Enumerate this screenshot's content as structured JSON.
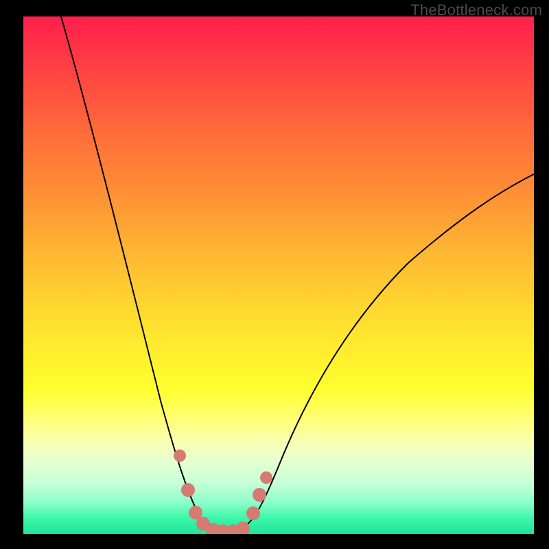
{
  "watermark": "TheBottleneck.com",
  "colors": {
    "background": "#000000",
    "gradient_top": "#ff1f4b",
    "gradient_bottom": "#20e39a",
    "curve": "#000000",
    "markers": "#d77a72"
  },
  "chart_data": {
    "type": "line",
    "title": "",
    "xlabel": "",
    "ylabel": "",
    "xlim": [
      0,
      100
    ],
    "ylim": [
      0,
      100
    ],
    "grid": false,
    "description": "V-shaped bottleneck curve with minimum near x≈38; background gradient from red (high bottleneck) at top to green (low bottleneck) at bottom.",
    "series": [
      {
        "name": "bottleneck-curve",
        "x": [
          7,
          10,
          14,
          18,
          22,
          26,
          28,
          30,
          32,
          34,
          36,
          38,
          40,
          42,
          44,
          46,
          48,
          52,
          58,
          66,
          76,
          88,
          100
        ],
        "y": [
          100,
          84,
          66,
          50,
          37,
          26,
          20,
          15,
          10,
          6,
          3,
          1,
          0.5,
          0.5,
          1,
          3,
          6,
          12,
          22,
          34,
          46,
          56,
          63
        ]
      }
    ],
    "markers": {
      "name": "highlighted-points",
      "color": "#d77a72",
      "points": [
        {
          "x": 30,
          "y": 15
        },
        {
          "x": 32,
          "y": 8
        },
        {
          "x": 33.5,
          "y": 3.5
        },
        {
          "x": 35,
          "y": 1.5
        },
        {
          "x": 37,
          "y": 0.5
        },
        {
          "x": 39,
          "y": 0.5
        },
        {
          "x": 41,
          "y": 0.5
        },
        {
          "x": 43,
          "y": 1
        },
        {
          "x": 45,
          "y": 4
        },
        {
          "x": 46,
          "y": 8
        },
        {
          "x": 47.5,
          "y": 11
        }
      ]
    }
  }
}
